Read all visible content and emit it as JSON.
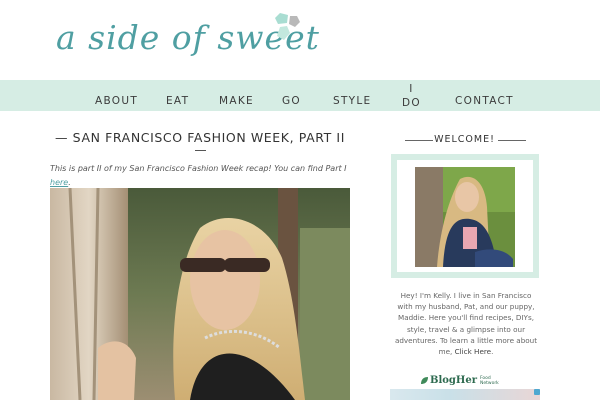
{
  "site": {
    "logo_text": "a side of sweet",
    "logo_alt": "a side of sweet",
    "colors": {
      "accent": "#4f9fa2",
      "nav_bg": "#d6ede4",
      "gem_light": "#a9ddd2",
      "gem_gray": "#b9b9b9"
    }
  },
  "nav": {
    "items": [
      {
        "label": "ABOUT"
      },
      {
        "label": "EAT"
      },
      {
        "label": "MAKE"
      },
      {
        "label": "GO"
      },
      {
        "label": "STYLE"
      },
      {
        "line1": "I",
        "line2": "DO"
      },
      {
        "label": "CONTACT"
      }
    ]
  },
  "post": {
    "title": "— SAN FRANCISCO FASHION WEEK, PART II",
    "intro": "This is part II of my San Francisco Fashion Week recap! You can find Part I",
    "intro_link": "here",
    "intro_end": ".",
    "photo_alt": "Woman in sunglasses leaning against a tree"
  },
  "sidebar": {
    "welcome_title": "WELCOME!",
    "avatar_alt": "Kelly sitting on the grass",
    "bio": "Hey! I'm Kelly. I live in San Francisco with my husband, Pat, and our puppy, Maddie. Here you'll find recipes, DIYs, style, travel & a glimpse into our adventures. To learn a little more about me,",
    "bio_link": "Click Here",
    "bio_end": ".",
    "blogher": {
      "label": "BlogHer",
      "line1": "Food",
      "line2": "Network"
    }
  }
}
